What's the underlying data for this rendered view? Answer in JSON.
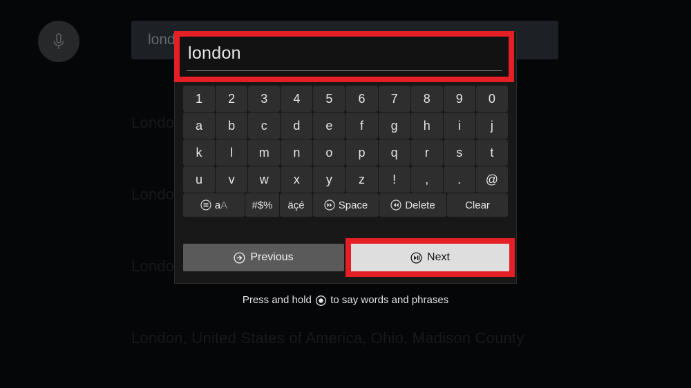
{
  "background": {
    "mic_button": {
      "icon": "microphone-icon"
    },
    "search_bar": {
      "value": "london"
    },
    "results": [
      "London, United Kingdom, England, Greater London",
      "London, Canada, Ontario, Middlesex County",
      "Londonderry, United Kingdom, Northern Ireland",
      "London, United States of America, Ohio, Madison County"
    ]
  },
  "dialog": {
    "input": {
      "value": "london",
      "focused": true,
      "focus_color": "#e41f26"
    },
    "keyboard": {
      "rows": [
        [
          "1",
          "2",
          "3",
          "4",
          "5",
          "6",
          "7",
          "8",
          "9",
          "0"
        ],
        [
          "a",
          "b",
          "c",
          "d",
          "e",
          "f",
          "g",
          "h",
          "i",
          "j"
        ],
        [
          "k",
          "l",
          "m",
          "n",
          "o",
          "p",
          "q",
          "r",
          "s",
          "t"
        ],
        [
          "u",
          "v",
          "w",
          "x",
          "y",
          "z",
          "!",
          ",",
          ".",
          "@"
        ]
      ],
      "function_row": [
        {
          "label_primary": "a",
          "label_secondary": "A",
          "icon": "menu-circle-icon",
          "name": "case-toggle"
        },
        {
          "label": "#$%",
          "name": "symbols"
        },
        {
          "label": "äçé",
          "name": "accents"
        },
        {
          "label": "Space",
          "icon": "fast-forward-circle-icon",
          "name": "space"
        },
        {
          "label": "Delete",
          "icon": "rewind-circle-icon",
          "name": "delete"
        },
        {
          "label": "Clear",
          "name": "clear"
        }
      ]
    },
    "nav": {
      "previous": {
        "label": "Previous",
        "icon": "back-circle-icon",
        "focused": false
      },
      "next": {
        "label": "Next",
        "icon": "play-pause-circle-icon",
        "focused": true
      }
    }
  },
  "hint": {
    "before": "Press and hold",
    "icon": "select-button-icon",
    "after": "to say words and phrases"
  }
}
